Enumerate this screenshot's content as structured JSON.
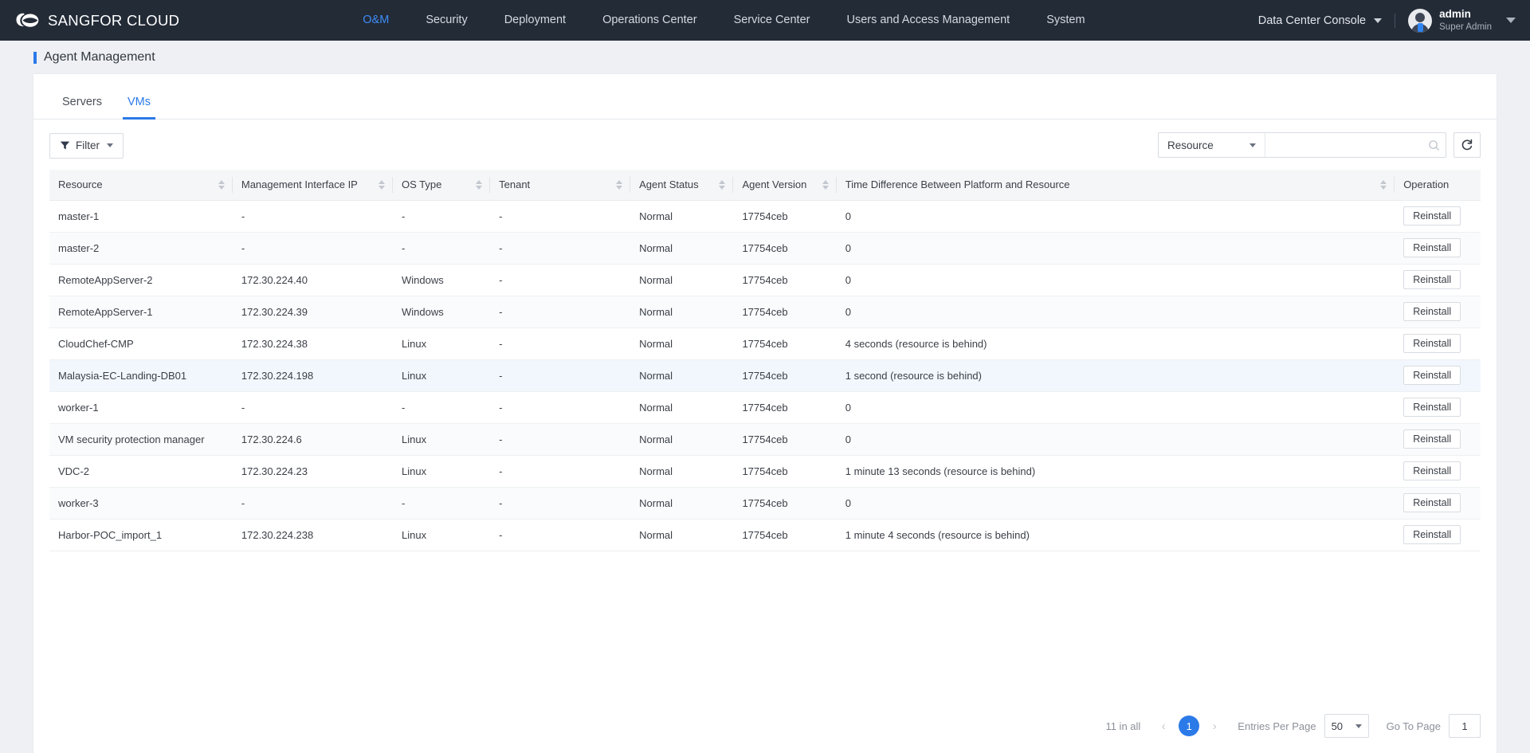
{
  "header": {
    "brand": "SANGFOR CLOUD",
    "logo_icon": "cloud-logo-icon",
    "nav": [
      {
        "label": "O&M",
        "active": true
      },
      {
        "label": "Security",
        "active": false
      },
      {
        "label": "Deployment",
        "active": false
      },
      {
        "label": "Operations Center",
        "active": false
      },
      {
        "label": "Service Center",
        "active": false
      },
      {
        "label": "Users and Access Management",
        "active": false
      },
      {
        "label": "System",
        "active": false
      }
    ],
    "console_selector": "Data Center Console",
    "user": {
      "name": "admin",
      "role": "Super Admin"
    }
  },
  "page": {
    "title": "Agent Management"
  },
  "tabs": [
    {
      "label": "Servers",
      "active": false
    },
    {
      "label": "VMs",
      "active": true
    }
  ],
  "toolbar": {
    "filter_label": "Filter",
    "search_field": "Resource",
    "search_value": "",
    "search_placeholder": "",
    "refresh_icon": "refresh-icon",
    "search_icon": "search-icon",
    "filter_icon": "funnel-icon"
  },
  "table": {
    "columns": [
      {
        "label": "Resource",
        "sortable": true,
        "width": "12.8%"
      },
      {
        "label": "Management Interface IP",
        "sortable": true,
        "width": "11.2%"
      },
      {
        "label": "OS Type",
        "sortable": true,
        "width": "6.8%"
      },
      {
        "label": "Tenant",
        "sortable": true,
        "width": "9.8%"
      },
      {
        "label": "Agent Status",
        "sortable": true,
        "width": "7.2%"
      },
      {
        "label": "Agent Version",
        "sortable": true,
        "width": "7.2%"
      },
      {
        "label": "Time Difference Between Platform and Resource",
        "sortable": true,
        "width": "39.0%"
      },
      {
        "label": "Operation",
        "sortable": false,
        "width": "6.0%"
      }
    ],
    "operation_label": "Reinstall",
    "rows": [
      {
        "resource": "master-1",
        "ip": "-",
        "os": "-",
        "tenant": "-",
        "status": "Normal",
        "version": "17754ceb",
        "timediff": "0",
        "op": "Reinstall",
        "highlight": false
      },
      {
        "resource": "master-2",
        "ip": "-",
        "os": "-",
        "tenant": "-",
        "status": "Normal",
        "version": "17754ceb",
        "timediff": "0",
        "op": "Reinstall",
        "highlight": false
      },
      {
        "resource": "RemoteAppServer-2",
        "ip": "172.30.224.40",
        "os": "Windows",
        "tenant": "-",
        "status": "Normal",
        "version": "17754ceb",
        "timediff": "0",
        "op": "Reinstall",
        "highlight": false
      },
      {
        "resource": "RemoteAppServer-1",
        "ip": "172.30.224.39",
        "os": "Windows",
        "tenant": "-",
        "status": "Normal",
        "version": "17754ceb",
        "timediff": "0",
        "op": "Reinstall",
        "highlight": false
      },
      {
        "resource": "CloudChef-CMP",
        "ip": "172.30.224.38",
        "os": "Linux",
        "tenant": "-",
        "status": "Normal",
        "version": "17754ceb",
        "timediff": "4 seconds (resource is behind)",
        "op": "Reinstall",
        "highlight": false
      },
      {
        "resource": "Malaysia-EC-Landing-DB01",
        "ip": "172.30.224.198",
        "os": "Linux",
        "tenant": "-",
        "status": "Normal",
        "version": "17754ceb",
        "timediff": "1 second (resource is behind)",
        "op": "Reinstall",
        "highlight": true
      },
      {
        "resource": "worker-1",
        "ip": "-",
        "os": "-",
        "tenant": "-",
        "status": "Normal",
        "version": "17754ceb",
        "timediff": "0",
        "op": "Reinstall",
        "highlight": false
      },
      {
        "resource": "VM security protection manager",
        "ip": "172.30.224.6",
        "os": "Linux",
        "tenant": "-",
        "status": "Normal",
        "version": "17754ceb",
        "timediff": "0",
        "op": "Reinstall",
        "highlight": false
      },
      {
        "resource": "VDC-2",
        "ip": "172.30.224.23",
        "os": "Linux",
        "tenant": "-",
        "status": "Normal",
        "version": "17754ceb",
        "timediff": "1 minute 13 seconds (resource is behind)",
        "op": "Reinstall",
        "highlight": false
      },
      {
        "resource": "worker-3",
        "ip": "-",
        "os": "-",
        "tenant": "-",
        "status": "Normal",
        "version": "17754ceb",
        "timediff": "0",
        "op": "Reinstall",
        "highlight": false
      },
      {
        "resource": "Harbor-POC_import_1",
        "ip": "172.30.224.238",
        "os": "Linux",
        "tenant": "-",
        "status": "Normal",
        "version": "17754ceb",
        "timediff": "1 minute 4 seconds (resource is behind)",
        "op": "Reinstall",
        "highlight": false
      }
    ]
  },
  "pagination": {
    "total_label": "11 in all",
    "prev_icon": "chevron-left-icon",
    "next_icon": "chevron-right-icon",
    "current_page": "1",
    "entries_per_page_label": "Entries Per Page",
    "entries_per_page_value": "50",
    "go_to_page_label": "Go To Page",
    "go_to_page_value": "1"
  },
  "colors": {
    "accent": "#2b7ae8",
    "header_bg": "#232b37",
    "page_bg": "#eef0f3"
  }
}
